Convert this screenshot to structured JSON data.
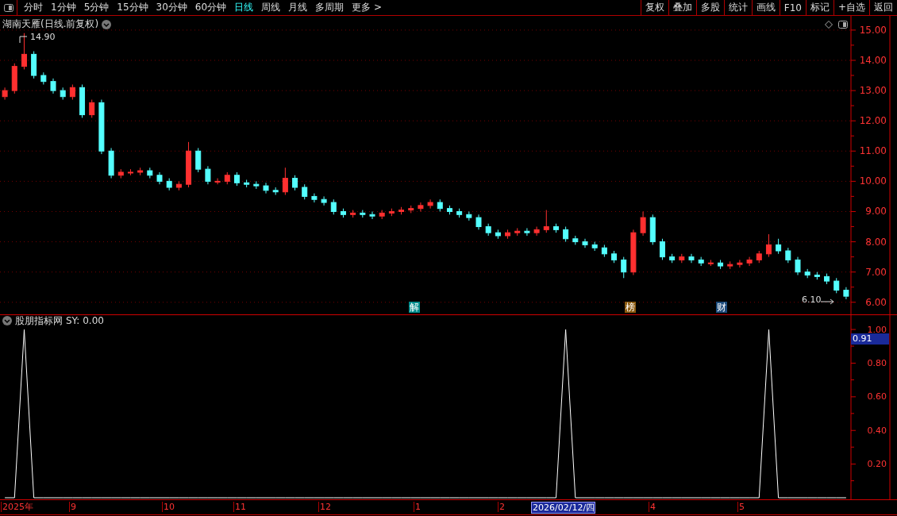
{
  "toolbar": {
    "periods": [
      {
        "label": "分时",
        "selected": false
      },
      {
        "label": "1分钟",
        "selected": false
      },
      {
        "label": "5分钟",
        "selected": false
      },
      {
        "label": "15分钟",
        "selected": false
      },
      {
        "label": "30分钟",
        "selected": false
      },
      {
        "label": "60分钟",
        "selected": false
      },
      {
        "label": "日线",
        "selected": true
      },
      {
        "label": "周线",
        "selected": false
      },
      {
        "label": "月线",
        "selected": false
      },
      {
        "label": "多周期",
        "selected": false
      },
      {
        "label": "更多 >",
        "selected": false
      }
    ],
    "buttons": [
      "复权",
      "叠加",
      "多股",
      "统计",
      "画线",
      "F10",
      "标记",
      "+自选",
      "返回"
    ]
  },
  "price_pane": {
    "title": "湖南天雁(日线.前复权)",
    "high_label": "14.90",
    "low_label": "6.10",
    "markers": [
      {
        "label": "解",
        "color": "#008b8b"
      },
      {
        "label": "榜",
        "color": "#8b5a10"
      },
      {
        "label": "财",
        "color": "#1c4a7a"
      }
    ],
    "chart_data": {
      "type": "candlestick",
      "grid": true,
      "ylim": [
        5.6,
        15.47
      ],
      "categories": [
        null,
        null,
        null,
        null,
        null,
        null,
        null,
        null,
        null,
        null,
        null,
        null,
        null,
        null,
        null,
        null,
        null,
        null,
        null,
        null,
        null,
        null,
        null,
        null,
        null,
        null,
        null,
        null,
        null,
        null,
        null,
        null,
        null,
        null,
        null,
        null,
        null,
        null,
        null,
        null,
        null,
        null,
        null,
        null,
        null,
        null,
        null,
        null,
        null,
        null,
        null,
        null,
        null,
        null,
        null,
        null,
        null,
        null,
        null,
        null,
        null,
        null,
        null,
        null,
        null,
        null,
        null,
        null,
        null,
        null,
        null,
        null,
        null,
        null,
        null,
        null,
        null,
        null,
        null,
        null,
        null,
        null,
        null,
        null,
        null,
        null,
        null,
        null
      ],
      "yticks": [
        {
          "value": 6,
          "label": "6.00"
        },
        {
          "value": 7,
          "label": "7.00"
        },
        {
          "value": 8,
          "label": "8.00"
        },
        {
          "value": 9,
          "label": "9.00"
        },
        {
          "value": 10,
          "label": "10.00"
        },
        {
          "value": 11,
          "label": "11.00"
        },
        {
          "value": 12,
          "label": "12.00"
        },
        {
          "value": 13,
          "label": "13.00"
        },
        {
          "value": 14,
          "label": "14.00"
        },
        {
          "value": 15,
          "label": "15.00"
        }
      ],
      "ohlc": [
        [
          12.8,
          13.1,
          12.7,
          13.0
        ],
        [
          13.0,
          13.9,
          12.9,
          13.8
        ],
        [
          13.8,
          14.9,
          13.7,
          14.2
        ],
        [
          14.2,
          14.3,
          13.4,
          13.5
        ],
        [
          13.5,
          13.6,
          13.2,
          13.3
        ],
        [
          13.3,
          13.4,
          12.9,
          13.0
        ],
        [
          13.0,
          13.1,
          12.7,
          12.8
        ],
        [
          12.8,
          13.2,
          12.7,
          13.1
        ],
        [
          13.1,
          13.2,
          12.1,
          12.2
        ],
        [
          12.2,
          12.7,
          12.1,
          12.6
        ],
        [
          12.6,
          12.7,
          10.9,
          11.0
        ],
        [
          11.0,
          11.1,
          10.1,
          10.2
        ],
        [
          10.2,
          10.4,
          10.1,
          10.3
        ],
        [
          10.3,
          10.4,
          10.2,
          10.3
        ],
        [
          10.3,
          10.45,
          10.2,
          10.35
        ],
        [
          10.35,
          10.45,
          10.1,
          10.2
        ],
        [
          10.2,
          10.3,
          9.9,
          10.0
        ],
        [
          10.0,
          10.1,
          9.7,
          9.8
        ],
        [
          9.8,
          10.0,
          9.7,
          9.9
        ],
        [
          9.9,
          11.3,
          9.8,
          11.0
        ],
        [
          11.0,
          11.1,
          10.3,
          10.4
        ],
        [
          10.4,
          10.5,
          9.9,
          10.0
        ],
        [
          10.0,
          10.1,
          9.9,
          10.0
        ],
        [
          10.0,
          10.3,
          9.9,
          10.2
        ],
        [
          10.2,
          10.3,
          9.85,
          9.95
        ],
        [
          9.95,
          10.05,
          9.8,
          9.9
        ],
        [
          9.9,
          10.0,
          9.75,
          9.85
        ],
        [
          9.85,
          9.95,
          9.6,
          9.7
        ],
        [
          9.7,
          9.8,
          9.55,
          9.65
        ],
        [
          9.65,
          10.45,
          9.55,
          10.1
        ],
        [
          10.1,
          10.2,
          9.7,
          9.8
        ],
        [
          9.8,
          9.9,
          9.4,
          9.5
        ],
        [
          9.5,
          9.6,
          9.3,
          9.4
        ],
        [
          9.4,
          9.5,
          9.2,
          9.3
        ],
        [
          9.3,
          9.4,
          8.9,
          9.0
        ],
        [
          9.0,
          9.1,
          8.8,
          8.9
        ],
        [
          8.9,
          9.05,
          8.8,
          8.95
        ],
        [
          8.95,
          9.05,
          8.8,
          8.9
        ],
        [
          8.9,
          9.0,
          8.75,
          8.85
        ],
        [
          8.85,
          9.05,
          8.75,
          8.95
        ],
        [
          8.95,
          9.1,
          8.85,
          9.0
        ],
        [
          9.0,
          9.15,
          8.9,
          9.05
        ],
        [
          9.05,
          9.2,
          8.95,
          9.1
        ],
        [
          9.1,
          9.3,
          9.0,
          9.2
        ],
        [
          9.2,
          9.4,
          9.1,
          9.3
        ],
        [
          9.3,
          9.4,
          9.0,
          9.1
        ],
        [
          9.1,
          9.2,
          8.9,
          9.0
        ],
        [
          9.0,
          9.1,
          8.8,
          8.9
        ],
        [
          8.9,
          9.0,
          8.7,
          8.8
        ],
        [
          8.8,
          8.9,
          8.4,
          8.5
        ],
        [
          8.5,
          8.6,
          8.2,
          8.3
        ],
        [
          8.3,
          8.4,
          8.1,
          8.2
        ],
        [
          8.2,
          8.4,
          8.1,
          8.3
        ],
        [
          8.3,
          8.45,
          8.2,
          8.35
        ],
        [
          8.35,
          8.45,
          8.2,
          8.3
        ],
        [
          8.3,
          8.5,
          8.2,
          8.4
        ],
        [
          8.4,
          9.05,
          8.3,
          8.5
        ],
        [
          8.5,
          8.6,
          8.3,
          8.4
        ],
        [
          8.4,
          8.5,
          8.0,
          8.1
        ],
        [
          8.1,
          8.2,
          7.9,
          8.0
        ],
        [
          8.0,
          8.1,
          7.8,
          7.9
        ],
        [
          7.9,
          8.0,
          7.7,
          7.8
        ],
        [
          7.8,
          7.9,
          7.5,
          7.6
        ],
        [
          7.6,
          7.7,
          7.3,
          7.4
        ],
        [
          7.4,
          7.5,
          6.8,
          7.0
        ],
        [
          7.0,
          8.4,
          6.9,
          8.3
        ],
        [
          8.3,
          9.0,
          8.2,
          8.8
        ],
        [
          8.8,
          8.9,
          7.9,
          8.0
        ],
        [
          8.0,
          8.1,
          7.4,
          7.5
        ],
        [
          7.5,
          7.6,
          7.3,
          7.4
        ],
        [
          7.4,
          7.6,
          7.3,
          7.5
        ],
        [
          7.5,
          7.6,
          7.3,
          7.4
        ],
        [
          7.4,
          7.5,
          7.2,
          7.3
        ],
        [
          7.3,
          7.4,
          7.2,
          7.3
        ],
        [
          7.3,
          7.4,
          7.1,
          7.2
        ],
        [
          7.2,
          7.35,
          7.1,
          7.25
        ],
        [
          7.25,
          7.4,
          7.15,
          7.3
        ],
        [
          7.3,
          7.5,
          7.2,
          7.4
        ],
        [
          7.4,
          7.7,
          7.3,
          7.6
        ],
        [
          7.6,
          8.25,
          7.5,
          7.9
        ],
        [
          7.9,
          8.1,
          7.6,
          7.7
        ],
        [
          7.7,
          7.8,
          7.3,
          7.4
        ],
        [
          7.4,
          7.5,
          6.9,
          7.0
        ],
        [
          7.0,
          7.1,
          6.8,
          6.9
        ],
        [
          6.9,
          7.0,
          6.75,
          6.85
        ],
        [
          6.85,
          6.95,
          6.6,
          6.7
        ],
        [
          6.7,
          6.8,
          6.3,
          6.4
        ],
        [
          6.4,
          6.5,
          6.1,
          6.2
        ]
      ]
    }
  },
  "indicator_pane": {
    "title": "股朋指标网",
    "reading": "SY: 0.00",
    "cursor_value": "0.91",
    "chart_data": {
      "type": "line",
      "ylim": [
        0,
        1.09
      ],
      "yticks": [
        {
          "value": 0.2,
          "label": "0.20"
        },
        {
          "value": 0.4,
          "label": "0.40"
        },
        {
          "value": 0.6,
          "label": "0.60"
        },
        {
          "value": 0.8,
          "label": "0.80"
        },
        {
          "value": 1,
          "label": "1.00"
        }
      ],
      "series": [
        {
          "color": "#ffffff",
          "values": [
            0,
            0,
            1,
            0,
            0,
            0,
            0,
            0,
            0,
            0,
            0,
            0,
            0,
            0,
            0,
            0,
            0,
            0,
            0,
            0,
            0,
            0,
            0,
            0,
            0,
            0,
            0,
            0,
            0,
            0,
            0,
            0,
            0,
            0,
            0,
            0,
            0,
            0,
            0,
            0,
            0,
            0,
            0,
            0,
            0,
            0,
            0,
            0,
            0,
            0,
            0,
            0,
            0,
            0,
            0,
            0,
            0,
            0,
            1,
            0,
            0,
            0,
            0,
            0,
            0,
            0,
            0,
            0,
            0,
            0,
            0,
            0,
            0,
            0,
            0,
            0,
            0,
            0,
            0,
            1,
            0,
            0,
            0,
            0,
            0,
            0,
            0,
            0
          ]
        }
      ]
    }
  },
  "date_axis": [
    {
      "label": "2025年",
      "selected": false
    },
    {
      "label": "9",
      "selected": false
    },
    {
      "label": "10",
      "selected": false
    },
    {
      "label": "11",
      "selected": false
    },
    {
      "label": "12",
      "selected": false
    },
    {
      "label": "1",
      "selected": false
    },
    {
      "label": "2",
      "selected": false
    },
    {
      "label": "2026/02/12/四",
      "selected": true
    },
    {
      "label": "4",
      "selected": false
    },
    {
      "label": "5",
      "selected": false
    }
  ]
}
